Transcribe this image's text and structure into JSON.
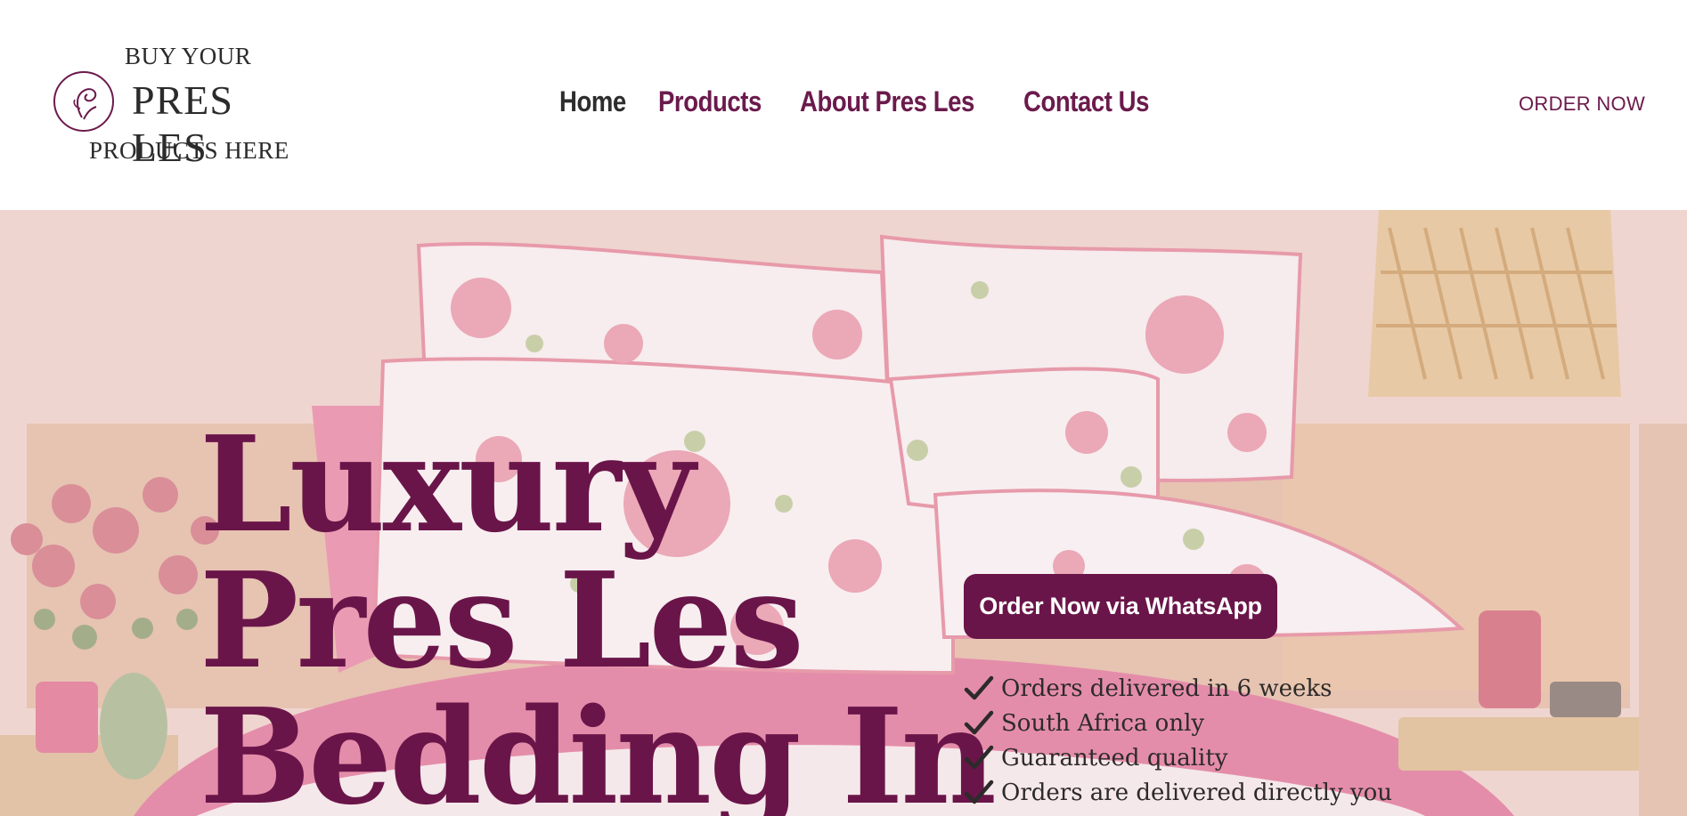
{
  "header": {
    "logo": {
      "top_line": "BUY YOUR",
      "brand": "PRES LES",
      "bottom_line": "PRODUCTS HERE"
    },
    "nav": [
      {
        "label": "Home",
        "active": true
      },
      {
        "label": "Products",
        "active": false
      },
      {
        "label": "About Pres Les",
        "active": false
      },
      {
        "label": "Contact Us",
        "active": false
      }
    ],
    "order_link": "ORDER NOW"
  },
  "hero": {
    "title_lines": [
      "Luxury",
      "Pres Les",
      "Bedding In"
    ],
    "cta_label": "Order Now via WhatsApp",
    "features": [
      "Orders delivered in 6 weeks",
      "South Africa only",
      "Guaranteed quality",
      "Orders are delivered directly you"
    ]
  },
  "colors": {
    "accent": "#6a1549",
    "text_dark": "#2d2d2d",
    "hero_tint": "#ecd2cd"
  },
  "icons": [
    "rose-logo-icon",
    "check-icon"
  ]
}
